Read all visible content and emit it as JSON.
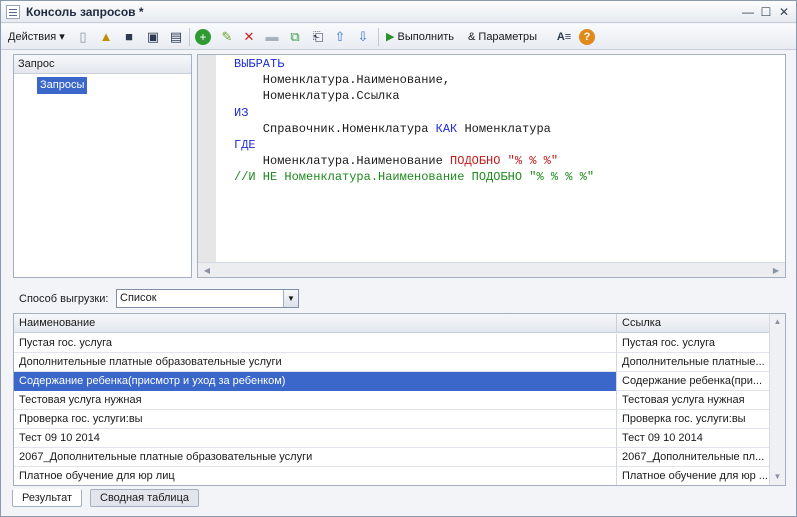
{
  "window": {
    "title": "Консоль запросов *"
  },
  "toolbar": {
    "actions_label": "Действия",
    "run_label": "Выполнить",
    "params_label": "Параметры"
  },
  "tree": {
    "header": "Запрос",
    "items": [
      "Запросы"
    ]
  },
  "editor": {
    "lines": [
      {
        "text": "ВЫБРАТЬ",
        "kind": "kw"
      },
      {
        "text": "    Номенклатура.Наименование,",
        "kind": "plain"
      },
      {
        "text": "    Номенклатура.Ссылка",
        "kind": "plain"
      },
      {
        "text": "ИЗ",
        "kind": "kw"
      },
      {
        "text": "    Справочник.Номенклатура ",
        "kind": "plain",
        "tail": [
          {
            "text": "КАК",
            "kind": "kw"
          },
          {
            "text": " Номенклатура",
            "kind": "plain"
          }
        ]
      },
      {
        "text": "ГДЕ",
        "kind": "kw"
      },
      {
        "text": "    Номенклатура.Наименование ",
        "kind": "plain",
        "tail": [
          {
            "text": "ПОДОБНО \"% % %\"",
            "kind": "str"
          }
        ]
      },
      {
        "text": "//И НЕ Номенклатура.Наименование ПОДОБНО \"% % % %\"",
        "kind": "cmt"
      }
    ]
  },
  "export": {
    "label": "Способ выгрузки:",
    "value": "Список"
  },
  "grid": {
    "columns": [
      "Наименование",
      "Ссылка"
    ],
    "rows": [
      [
        "Пустая гос. услуга",
        "Пустая гос. услуга"
      ],
      [
        "Дополнительные платные образовательные услуги",
        "Дополнительные платные..."
      ],
      [
        "Содержание ребенка(присмотр и уход за ребенком)",
        "Содержание ребенка(при..."
      ],
      [
        "Тестовая услуга нужная",
        "Тестовая услуга нужная"
      ],
      [
        "Проверка гос. услуги:вы",
        "Проверка гос. услуги:вы"
      ],
      [
        "Тест 09 10 2014",
        "Тест 09 10 2014"
      ],
      [
        "2067_Дополнительные платные образовательные услуги",
        "2067_Дополнительные пл..."
      ],
      [
        "Платное обучение для юр лиц",
        "Платное обучение для юр ..."
      ]
    ],
    "selected_row": 2
  },
  "tabs": [
    "Результат",
    "Сводная таблица"
  ],
  "colors": {
    "selection": "#3a67c9",
    "keyword": "#1e2dd6",
    "string": "#c21818",
    "comment": "#1b8a1b"
  },
  "icons": [
    "new-icon",
    "open-icon",
    "save-icon",
    "save-as-icon",
    "save-copy-icon",
    "add-icon",
    "edit-icon",
    "delete-icon",
    "disabled-icon",
    "copy-icon",
    "query-builder-icon",
    "move-up-icon",
    "move-down-icon",
    "run-icon",
    "params-icon",
    "text-format-icon",
    "help-icon"
  ]
}
